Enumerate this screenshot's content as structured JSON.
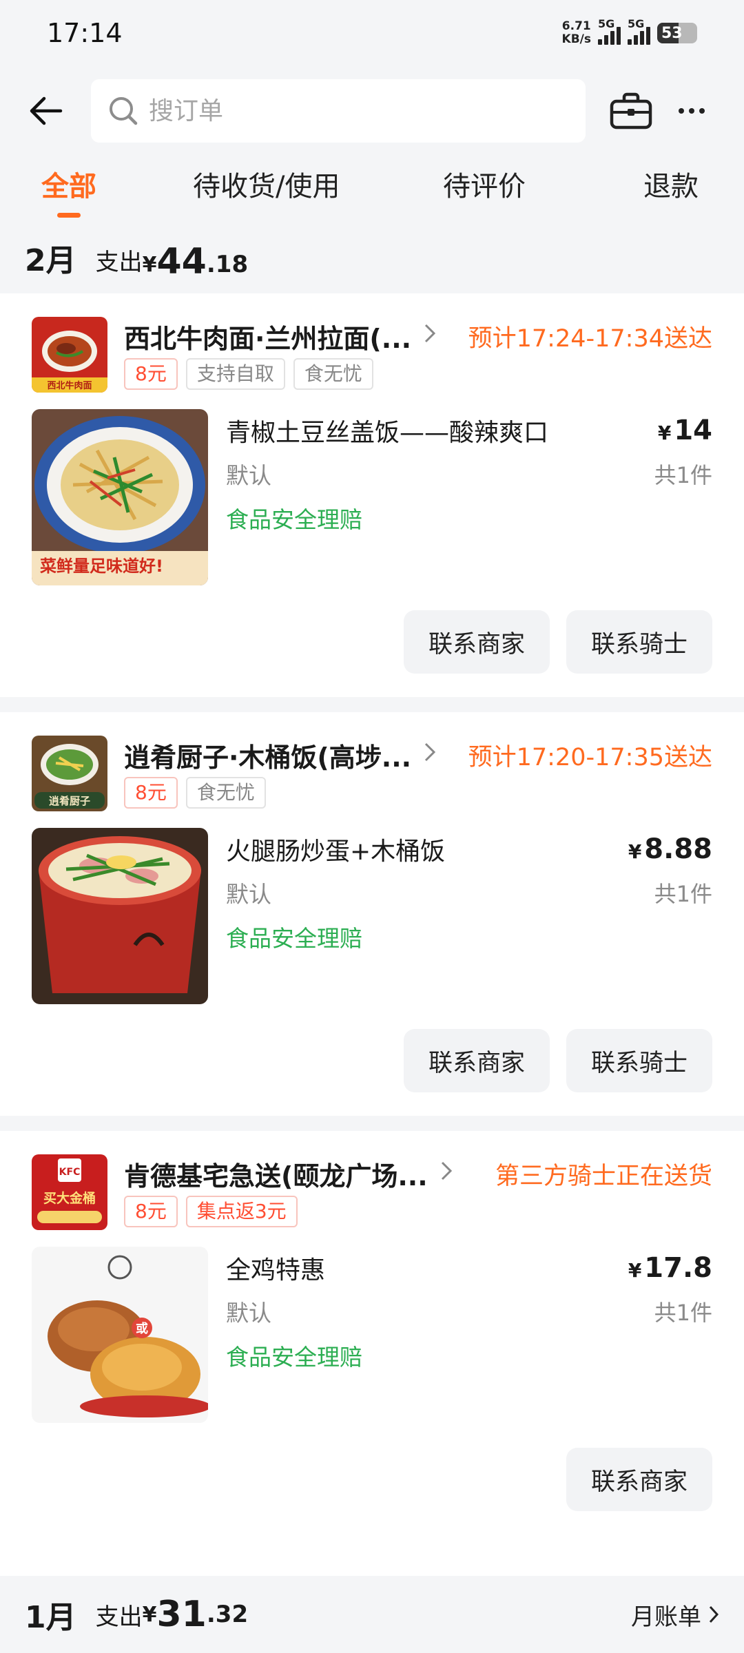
{
  "status": {
    "time": "17:14",
    "netspeed_value": "6.71",
    "netspeed_unit": "KB/s",
    "sim1": "5G",
    "sim2": "5G",
    "battery": "53"
  },
  "search": {
    "placeholder": "搜订单"
  },
  "tabs": [
    {
      "label": "全部",
      "active": true
    },
    {
      "label": "待收货/使用",
      "active": false
    },
    {
      "label": "待评价",
      "active": false
    },
    {
      "label": "退款",
      "active": false
    }
  ],
  "feb": {
    "month": "2月",
    "spend_label": "支出",
    "currency": "¥",
    "amount_int": "44",
    "amount_dec": ".18"
  },
  "orders": [
    {
      "shop": "西北牛肉面·兰州拉面(...",
      "delivery": "预计17:24-17:34送达",
      "tags": [
        "8元",
        "支持自取",
        "食无忧"
      ],
      "item": "青椒土豆丝盖饭——酸辣爽口",
      "currency": "¥",
      "price": "14",
      "variant": "默认",
      "qty": "共1件",
      "safety": "食品安全理赔",
      "buttons": [
        "联系商家",
        "联系骑士"
      ],
      "logo_text": "西北牛肉面",
      "thumb_text": "菜鲜量足味道好!"
    },
    {
      "shop": "逍肴厨子·木桶饭(高埗...",
      "delivery": "预计17:20-17:35送达",
      "tags": [
        "8元",
        "食无忧"
      ],
      "item": "火腿肠炒蛋+木桶饭",
      "currency": "¥",
      "price": "8.88",
      "variant": "默认",
      "qty": "共1件",
      "safety": "食品安全理赔",
      "buttons": [
        "联系商家",
        "联系骑士"
      ],
      "logo_text": "逍肴厨子"
    },
    {
      "shop": "肯德基宅急送(颐龙广场...",
      "delivery": "第三方骑士正在送货",
      "tags": [
        "8元",
        "集点返3元"
      ],
      "item": "全鸡特惠",
      "currency": "¥",
      "price": "17.8",
      "variant": "默认",
      "qty": "共1件",
      "safety": "食品安全理赔",
      "buttons": [
        "联系商家"
      ],
      "logo_text": "KFC",
      "logo_sub": "买大金桶",
      "thumb_badge": "或"
    }
  ],
  "jan": {
    "month": "1月",
    "spend_label": "支出",
    "currency": "¥",
    "amount_int": "31",
    "amount_dec": ".32",
    "bill_label": "月账单"
  },
  "colors": {
    "accent": "#ff6a1f",
    "safety": "#2cae52",
    "tag_red": "#ff4e33"
  }
}
